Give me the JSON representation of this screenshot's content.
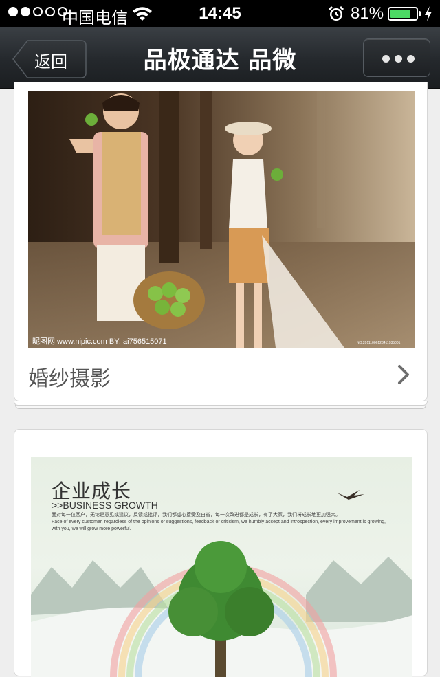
{
  "status_bar": {
    "carrier": "中国电信",
    "time": "14:45",
    "battery_percent_text": "81%",
    "battery_level": 0.81,
    "signal_bars_filled": 2,
    "signal_bars_total": 5
  },
  "navbar": {
    "back_label": "返回",
    "title": "品极通达 品微",
    "more_icon": "ellipsis-icon"
  },
  "cards": [
    {
      "title": "婚纱摄影",
      "image_watermark": "昵图网 www.nipic.com BY: ai756515071",
      "image_watermark_no": "NO:20111006123411935001"
    },
    {
      "image_title": "企业成长",
      "image_subtitle": ">>BUSINESS GROWTH",
      "image_text_cn": "面对每一位客户，无论是意见或建议，反馈或批评，我们都虚心接受及自省，每一次改进都是成长，有了大家，我们将成长地更加强大。",
      "image_text_en": "Face of every customer, regardless of the opinions or suggestions, feedback or criticism, we humbly accept and introspection, every improvement is growing, with you, we will grow more powerful."
    }
  ],
  "colors": {
    "navbar": "#24282c",
    "page_background": "#eeeeee",
    "battery_green": "#4cd964"
  }
}
